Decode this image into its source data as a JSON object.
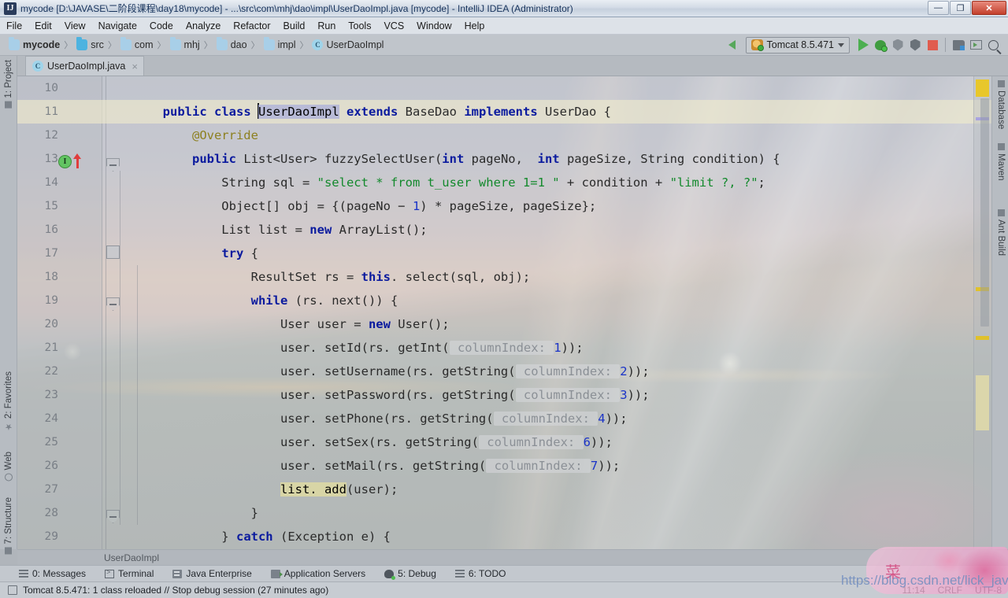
{
  "window": {
    "title": "mycode [D:\\JAVASE\\二阶段课程\\day18\\mycode] - ...\\src\\com\\mhj\\dao\\impl\\UserDaoImpl.java [mycode] - IntelliJ IDEA (Administrator)",
    "app_icon": "IJ",
    "minimize": "—",
    "maximize": "❐",
    "close": "✕"
  },
  "menubar": {
    "items": [
      {
        "label": "File"
      },
      {
        "label": "Edit"
      },
      {
        "label": "View"
      },
      {
        "label": "Navigate"
      },
      {
        "label": "Code"
      },
      {
        "label": "Analyze"
      },
      {
        "label": "Refactor"
      },
      {
        "label": "Build"
      },
      {
        "label": "Run"
      },
      {
        "label": "Tools"
      },
      {
        "label": "VCS"
      },
      {
        "label": "Window"
      },
      {
        "label": "Help"
      }
    ]
  },
  "navbar": {
    "breadcrumbs": [
      {
        "label": "mycode",
        "icon": "folder-icon"
      },
      {
        "label": "src",
        "icon": "folder-icon"
      },
      {
        "label": "com",
        "icon": "folder-icon"
      },
      {
        "label": "mhj",
        "icon": "folder-icon"
      },
      {
        "label": "dao",
        "icon": "folder-icon"
      },
      {
        "label": "impl",
        "icon": "folder-icon"
      },
      {
        "label": "UserDaoImpl",
        "icon": "class-icon"
      }
    ],
    "separator": "〉",
    "run_config": "Tomcat 8.5.471",
    "toolbar_icons": [
      "back-arrow-icon",
      "run-icon",
      "debug-icon",
      "run-with-coverage-icon",
      "profile-icon",
      "stop-icon",
      "restore-layout-icon",
      "open-terminal-icon",
      "search-everywhere-icon"
    ]
  },
  "tabs": [
    {
      "label": "UserDaoImpl.java",
      "icon": "java-class-icon",
      "close": "×",
      "active": true
    }
  ],
  "left_tool_strip": [
    {
      "label": "1: Project",
      "icon": "project-icon"
    },
    {
      "label": "2: Favorites",
      "icon": "star-icon"
    },
    {
      "label": "Web",
      "icon": "globe-icon"
    },
    {
      "label": "7: Structure",
      "icon": "structure-icon"
    }
  ],
  "right_tool_strip": [
    {
      "label": "Database",
      "icon": "database-icon"
    },
    {
      "label": "Maven",
      "icon": "maven-icon"
    },
    {
      "label": "Ant Build",
      "icon": "ant-icon"
    }
  ],
  "editor": {
    "file": "UserDaoImpl.java",
    "breadcrumb": "UserDaoImpl",
    "caret_line": 11,
    "lines": [
      {
        "no": "10",
        "tokens": []
      },
      {
        "no": "11",
        "tokens": [
          {
            "t": "        ",
            "c": "plain"
          },
          {
            "t": "public",
            "c": "kw"
          },
          {
            "t": " ",
            "c": "plain"
          },
          {
            "t": "class",
            "c": "kw"
          },
          {
            "t": " ",
            "c": "plain"
          },
          {
            "t": "UserDaoImpl",
            "c": "sel"
          },
          {
            "t": " ",
            "c": "plain"
          },
          {
            "t": "extends",
            "c": "kw"
          },
          {
            "t": " ",
            "c": "plain"
          },
          {
            "t": "BaseDao",
            "c": "plain"
          },
          {
            "t": " ",
            "c": "plain"
          },
          {
            "t": "implements",
            "c": "kw"
          },
          {
            "t": " ",
            "c": "plain"
          },
          {
            "t": "UserDao {",
            "c": "plain"
          }
        ]
      },
      {
        "no": "12",
        "tokens": [
          {
            "t": "            @Override",
            "c": "ann"
          }
        ]
      },
      {
        "no": "13",
        "tokens": [
          {
            "t": "            ",
            "c": "plain"
          },
          {
            "t": "public",
            "c": "kw"
          },
          {
            "t": " List<User> fuzzySelectUser(",
            "c": "plain"
          },
          {
            "t": "int",
            "c": "kw"
          },
          {
            "t": " pageNo,  ",
            "c": "plain"
          },
          {
            "t": "int",
            "c": "kw"
          },
          {
            "t": " pageSize, String condition) {",
            "c": "plain"
          }
        ]
      },
      {
        "no": "14",
        "tokens": [
          {
            "t": "                String sql = ",
            "c": "plain"
          },
          {
            "t": "\"select * from t_user where 1=1 \"",
            "c": "str"
          },
          {
            "t": " + condition + ",
            "c": "plain"
          },
          {
            "t": "\"limit ?, ?\"",
            "c": "str"
          },
          {
            "t": ";",
            "c": "plain"
          }
        ]
      },
      {
        "no": "15",
        "tokens": [
          {
            "t": "                Object[] obj = {(pageNo − ",
            "c": "plain"
          },
          {
            "t": "1",
            "c": "num"
          },
          {
            "t": ") * pageSize, pageSize};",
            "c": "plain"
          }
        ]
      },
      {
        "no": "16",
        "tokens": [
          {
            "t": "                List list = ",
            "c": "plain"
          },
          {
            "t": "new",
            "c": "kw"
          },
          {
            "t": " ArrayList();",
            "c": "plain"
          }
        ]
      },
      {
        "no": "17",
        "tokens": [
          {
            "t": "                ",
            "c": "plain"
          },
          {
            "t": "try",
            "c": "kw"
          },
          {
            "t": " {",
            "c": "plain"
          }
        ]
      },
      {
        "no": "18",
        "tokens": [
          {
            "t": "                    ResultSet rs = ",
            "c": "plain"
          },
          {
            "t": "this",
            "c": "kw"
          },
          {
            "t": ". select(sql, obj);",
            "c": "plain"
          }
        ]
      },
      {
        "no": "19",
        "tokens": [
          {
            "t": "                    ",
            "c": "plain"
          },
          {
            "t": "while",
            "c": "kw"
          },
          {
            "t": " (rs. next()) {",
            "c": "plain"
          }
        ]
      },
      {
        "no": "20",
        "tokens": [
          {
            "t": "                        User user = ",
            "c": "plain"
          },
          {
            "t": "new",
            "c": "kw"
          },
          {
            "t": " User();",
            "c": "plain"
          }
        ]
      },
      {
        "no": "21",
        "tokens": [
          {
            "t": "                        user. setId(rs. getInt(",
            "c": "plain"
          },
          {
            "t": " columnIndex: ",
            "c": "hint"
          },
          {
            "t": "1",
            "c": "num"
          },
          {
            "t": "));",
            "c": "plain"
          }
        ]
      },
      {
        "no": "22",
        "tokens": [
          {
            "t": "                        user. setUsername(rs. getString(",
            "c": "plain"
          },
          {
            "t": " columnIndex: ",
            "c": "hint"
          },
          {
            "t": "2",
            "c": "num"
          },
          {
            "t": "));",
            "c": "plain"
          }
        ]
      },
      {
        "no": "23",
        "tokens": [
          {
            "t": "                        user. setPassword(rs. getString(",
            "c": "plain"
          },
          {
            "t": " columnIndex: ",
            "c": "hint"
          },
          {
            "t": "3",
            "c": "num"
          },
          {
            "t": "));",
            "c": "plain"
          }
        ]
      },
      {
        "no": "24",
        "tokens": [
          {
            "t": "                        user. setPhone(rs. getString(",
            "c": "plain"
          },
          {
            "t": " columnIndex: ",
            "c": "hint"
          },
          {
            "t": "4",
            "c": "num"
          },
          {
            "t": "));",
            "c": "plain"
          }
        ]
      },
      {
        "no": "25",
        "tokens": [
          {
            "t": "                        user. setSex(rs. getString(",
            "c": "plain"
          },
          {
            "t": " columnIndex: ",
            "c": "hint"
          },
          {
            "t": "6",
            "c": "num"
          },
          {
            "t": "));",
            "c": "plain"
          }
        ]
      },
      {
        "no": "26",
        "tokens": [
          {
            "t": "                        user. setMail(rs. getString(",
            "c": "plain"
          },
          {
            "t": " columnIndex: ",
            "c": "hint"
          },
          {
            "t": "7",
            "c": "num"
          },
          {
            "t": "));",
            "c": "plain"
          }
        ]
      },
      {
        "no": "27",
        "tokens": [
          {
            "t": "                        ",
            "c": "plain"
          },
          {
            "t": "list. add",
            "c": "occ"
          },
          {
            "t": "(user);",
            "c": "plain"
          }
        ]
      },
      {
        "no": "28",
        "tokens": [
          {
            "t": "                    }",
            "c": "plain"
          }
        ]
      },
      {
        "no": "29",
        "tokens": [
          {
            "t": "                } ",
            "c": "plain"
          },
          {
            "t": "catch",
            "c": "kw"
          },
          {
            "t": " (Exception e) {",
            "c": "plain"
          }
        ]
      }
    ],
    "gutter_marker": {
      "line": "13",
      "glyph": "I",
      "name": "implementing-method-marker"
    }
  },
  "bottom_tool_windows": [
    {
      "label": "0: Messages",
      "icon": "messages-icon"
    },
    {
      "label": "Terminal",
      "icon": "terminal-icon"
    },
    {
      "label": "Java Enterprise",
      "icon": "java-enterprise-icon"
    },
    {
      "label": "Application Servers",
      "icon": "application-servers-icon"
    },
    {
      "label": "5: Debug",
      "icon": "debug-icon"
    },
    {
      "label": "6: TODO",
      "icon": "todo-icon"
    }
  ],
  "statusbar": {
    "message": "Tomcat 8.5.471: 1 class reloaded // Stop debug session (27 minutes ago)",
    "caret_position": "11:14",
    "line_separator": "CRLF",
    "encoding": "UTF-8"
  },
  "watermark": {
    "url": "https://blog.csdn.net/lick_java",
    "badge_char": "菜"
  }
}
